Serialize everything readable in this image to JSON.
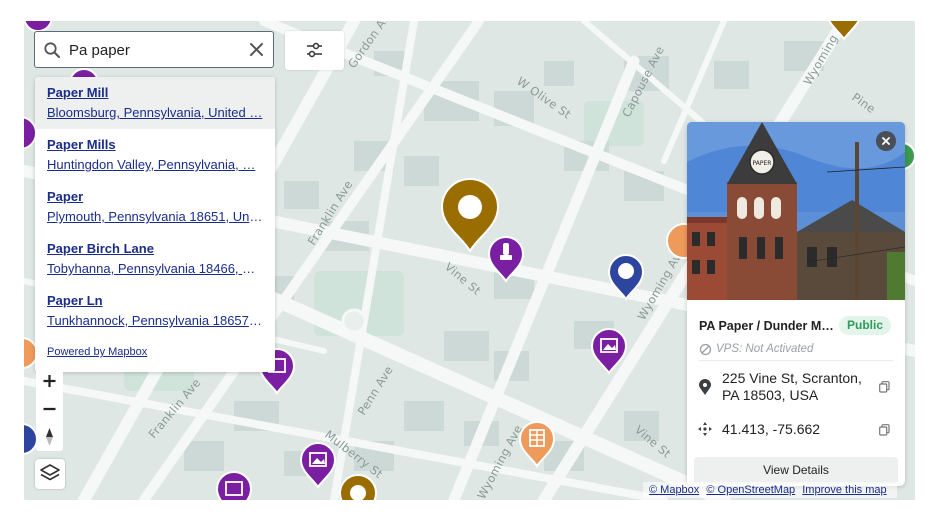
{
  "search": {
    "value": "Pa paper",
    "icon": "search-icon",
    "clear_icon": "close-icon"
  },
  "filter_button": {
    "icon": "sliders-icon"
  },
  "suggestions": [
    {
      "name": "Paper Mill",
      "address": "Bloomsburg, Pennsylvania, United …"
    },
    {
      "name": "Paper Mills",
      "address": "Huntingdon Valley, Pennsylvania, …"
    },
    {
      "name": "Paper",
      "address": "Plymouth, Pennsylvania 18651, Unit…"
    },
    {
      "name": "Paper Birch Lane",
      "address": "Tobyhanna, Pennsylvania 18466, U…"
    },
    {
      "name": "Paper Ln",
      "address": "Tunkhannock, Pennsylvania 18657, …"
    }
  ],
  "powered_by": "Powered by Mapbox",
  "streets": [
    "Gordon Ave",
    "W Olive St",
    "Capouse Ave",
    "Wyoming Ave",
    "Pine",
    "Franklin Ave",
    "Vine St",
    "Wyoming Ave",
    "Penn Ave",
    "Franklin Ave",
    "Mulberry St",
    "Vine St",
    "Wyoming Ave"
  ],
  "info_card": {
    "title": "PA Paper / Dunder Mi…",
    "status": "Public",
    "vps": "VPS: Not Activated",
    "address_line1": "225 Vine St, Scranton,",
    "address_line2": "PA 18503, USA",
    "coordinates": "41.413, -75.662",
    "button": "View Details",
    "photo_sign": "PAPER",
    "colors": {
      "status_text": "#2f9a5c",
      "status_bg": "#e3f5ea"
    }
  },
  "attribution": {
    "mapbox": "© Mapbox",
    "osm": "© OpenStreetMap",
    "improve": "Improve this map"
  },
  "colors": {
    "map_bg": "#dfe7e4",
    "road": "#f5f8f7",
    "building": "#c9d6d3",
    "park": "#c5e0d5",
    "marker_gold": "#9a6d00",
    "marker_purple": "#7a1fa2",
    "marker_blue": "#2e45a0",
    "marker_orange": "#ee9a5a",
    "link": "#1a2d8a"
  }
}
